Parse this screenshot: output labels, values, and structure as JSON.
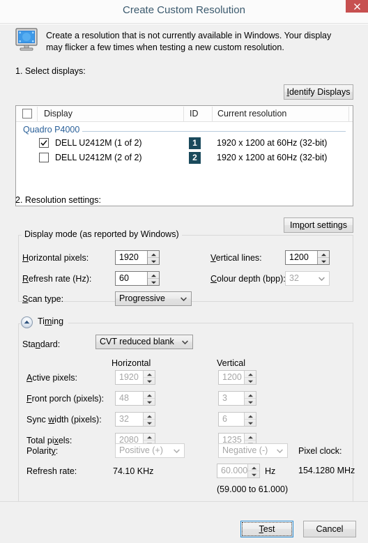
{
  "window": {
    "title": "Create Custom Resolution",
    "close_icon": "close-icon"
  },
  "header": {
    "icon": "monitor-icon",
    "description": "Create a resolution that is not currently available in Windows. Your display may flicker a few times when testing a new custom resolution."
  },
  "steps": {
    "step1_label": "1. Select displays:",
    "step2_label": "2. Resolution settings:"
  },
  "buttons": {
    "identify_displays": "Identify Displays",
    "identify_displays_accel": "I",
    "identify_displays_rest": "dentify Displays",
    "import_settings": "Import settings",
    "import_settings_pre": "Im",
    "import_settings_accel": "p",
    "import_settings_rest": "ort settings",
    "test": "Test",
    "test_accel": "T",
    "test_rest": "est",
    "cancel": "Cancel"
  },
  "display_list": {
    "columns": [
      "Display",
      "ID",
      "Current resolution"
    ],
    "group": "Quadro P4000",
    "rows": [
      {
        "checked": true,
        "name": "DELL U2412M (1 of 2)",
        "id": "1",
        "resolution": "1920 x 1200 at 60Hz (32-bit)"
      },
      {
        "checked": false,
        "name": "DELL U2412M (2 of 2)",
        "id": "2",
        "resolution": "1920 x 1200 at 60Hz (32-bit)"
      }
    ],
    "badge_color": "#1a4a5c",
    "group_color": "#2a6099"
  },
  "display_mode": {
    "group_title": "Display mode (as reported by Windows)",
    "horizontal_pixels": {
      "label": "Horizontal pixels:",
      "accel_pre": "",
      "accel": "H",
      "accel_rest": "orizontal pixels:",
      "value": "1920"
    },
    "vertical_lines": {
      "label": "Vertical lines:",
      "accel": "V",
      "accel_rest": "ertical lines:",
      "value": "1200"
    },
    "refresh_rate": {
      "label": "Refresh rate (Hz):",
      "accel": "R",
      "accel_rest": "efresh rate (Hz):",
      "value": "60"
    },
    "colour_depth": {
      "label": "Colour depth (bpp):",
      "accel": "C",
      "accel_rest": "olour depth (bpp):",
      "value": "32"
    },
    "scan_type": {
      "label": "Scan type:",
      "accel": "S",
      "accel_rest": "can type:",
      "value": "Progressive"
    }
  },
  "timing": {
    "section_title": "Timing",
    "section_title_pre": "Ti",
    "section_title_accel": "m",
    "section_title_rest": "ing",
    "expander_icon": "chevron-up-circle-icon",
    "standard": {
      "label": "Standard:",
      "label_pre": "Sta",
      "label_accel": "n",
      "label_rest": "dard:",
      "value": "CVT reduced blank"
    },
    "column_headers": {
      "horizontal": "Horizontal",
      "vertical": "Vertical"
    },
    "rows": [
      {
        "label": "Active pixels:",
        "label_pre": "",
        "label_accel": "A",
        "label_rest": "ctive pixels:",
        "horizontal": "1920",
        "vertical": "1200"
      },
      {
        "label": "Front porch (pixels):",
        "label_pre": "",
        "label_accel": "F",
        "label_rest": "ront porch (pixels):",
        "horizontal": "48",
        "vertical": "3"
      },
      {
        "label": "Sync width (pixels):",
        "label_pre": "Sync ",
        "label_accel": "w",
        "label_rest": "idth (pixels):",
        "horizontal": "32",
        "vertical": "6"
      },
      {
        "label": "Total pixels:",
        "label_pre": "Total pi",
        "label_accel": "x",
        "label_rest": "els:",
        "horizontal": "2080",
        "vertical": "1235"
      }
    ],
    "polarity": {
      "label": "Polarity:",
      "label_pre": "Polarit",
      "label_accel": "y",
      "label_rest": ":",
      "horizontal": "Positive (+)",
      "vertical": "Negative (-)"
    },
    "refresh_rate": {
      "label": "Refresh rate:",
      "horizontal_value": "74.10 KHz",
      "vertical_value": "60.000",
      "vertical_unit": "Hz",
      "range_note": "(59.000 to 61.000)"
    },
    "pixel_clock": {
      "label": "Pixel clock:",
      "value": "154.1280 MHz"
    }
  }
}
